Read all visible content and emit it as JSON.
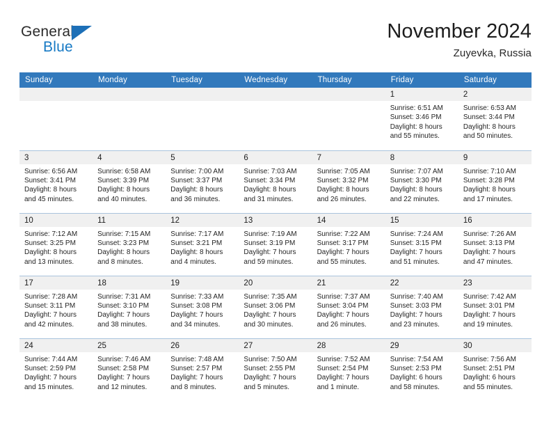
{
  "brand": {
    "name_top": "General",
    "name_bottom": "Blue",
    "accent_color": "#1679c4",
    "triangle_color": "#1c6fb7"
  },
  "header": {
    "title": "November 2024",
    "subtitle": "Zuyevka, Russia"
  },
  "theme": {
    "header_bg": "#3279bc",
    "header_text": "#ffffff",
    "daynum_band_bg": "#f0f0f0",
    "row_separator": "#a9c3dd",
    "cell_bg": "#ffffff",
    "body_text": "#242424"
  },
  "weekday_headers": [
    "Sunday",
    "Monday",
    "Tuesday",
    "Wednesday",
    "Thursday",
    "Friday",
    "Saturday"
  ],
  "labels": {
    "sunrise_prefix": "Sunrise:",
    "sunset_prefix": "Sunset:",
    "daylight_prefix": "Daylight:"
  },
  "weeks": [
    [
      {
        "day": "",
        "empty": true,
        "line1": "",
        "line2": "",
        "line3": "",
        "line4": ""
      },
      {
        "day": "",
        "empty": true,
        "line1": "",
        "line2": "",
        "line3": "",
        "line4": ""
      },
      {
        "day": "",
        "empty": true,
        "line1": "",
        "line2": "",
        "line3": "",
        "line4": ""
      },
      {
        "day": "",
        "empty": true,
        "line1": "",
        "line2": "",
        "line3": "",
        "line4": ""
      },
      {
        "day": "",
        "empty": true,
        "line1": "",
        "line2": "",
        "line3": "",
        "line4": ""
      },
      {
        "day": "1",
        "empty": false,
        "line1": "Sunrise: 6:51 AM",
        "line2": "Sunset: 3:46 PM",
        "line3": "Daylight: 8 hours",
        "line4": "and 55 minutes."
      },
      {
        "day": "2",
        "empty": false,
        "line1": "Sunrise: 6:53 AM",
        "line2": "Sunset: 3:44 PM",
        "line3": "Daylight: 8 hours",
        "line4": "and 50 minutes."
      }
    ],
    [
      {
        "day": "3",
        "empty": false,
        "line1": "Sunrise: 6:56 AM",
        "line2": "Sunset: 3:41 PM",
        "line3": "Daylight: 8 hours",
        "line4": "and 45 minutes."
      },
      {
        "day": "4",
        "empty": false,
        "line1": "Sunrise: 6:58 AM",
        "line2": "Sunset: 3:39 PM",
        "line3": "Daylight: 8 hours",
        "line4": "and 40 minutes."
      },
      {
        "day": "5",
        "empty": false,
        "line1": "Sunrise: 7:00 AM",
        "line2": "Sunset: 3:37 PM",
        "line3": "Daylight: 8 hours",
        "line4": "and 36 minutes."
      },
      {
        "day": "6",
        "empty": false,
        "line1": "Sunrise: 7:03 AM",
        "line2": "Sunset: 3:34 PM",
        "line3": "Daylight: 8 hours",
        "line4": "and 31 minutes."
      },
      {
        "day": "7",
        "empty": false,
        "line1": "Sunrise: 7:05 AM",
        "line2": "Sunset: 3:32 PM",
        "line3": "Daylight: 8 hours",
        "line4": "and 26 minutes."
      },
      {
        "day": "8",
        "empty": false,
        "line1": "Sunrise: 7:07 AM",
        "line2": "Sunset: 3:30 PM",
        "line3": "Daylight: 8 hours",
        "line4": "and 22 minutes."
      },
      {
        "day": "9",
        "empty": false,
        "line1": "Sunrise: 7:10 AM",
        "line2": "Sunset: 3:28 PM",
        "line3": "Daylight: 8 hours",
        "line4": "and 17 minutes."
      }
    ],
    [
      {
        "day": "10",
        "empty": false,
        "line1": "Sunrise: 7:12 AM",
        "line2": "Sunset: 3:25 PM",
        "line3": "Daylight: 8 hours",
        "line4": "and 13 minutes."
      },
      {
        "day": "11",
        "empty": false,
        "line1": "Sunrise: 7:15 AM",
        "line2": "Sunset: 3:23 PM",
        "line3": "Daylight: 8 hours",
        "line4": "and 8 minutes."
      },
      {
        "day": "12",
        "empty": false,
        "line1": "Sunrise: 7:17 AM",
        "line2": "Sunset: 3:21 PM",
        "line3": "Daylight: 8 hours",
        "line4": "and 4 minutes."
      },
      {
        "day": "13",
        "empty": false,
        "line1": "Sunrise: 7:19 AM",
        "line2": "Sunset: 3:19 PM",
        "line3": "Daylight: 7 hours",
        "line4": "and 59 minutes."
      },
      {
        "day": "14",
        "empty": false,
        "line1": "Sunrise: 7:22 AM",
        "line2": "Sunset: 3:17 PM",
        "line3": "Daylight: 7 hours",
        "line4": "and 55 minutes."
      },
      {
        "day": "15",
        "empty": false,
        "line1": "Sunrise: 7:24 AM",
        "line2": "Sunset: 3:15 PM",
        "line3": "Daylight: 7 hours",
        "line4": "and 51 minutes."
      },
      {
        "day": "16",
        "empty": false,
        "line1": "Sunrise: 7:26 AM",
        "line2": "Sunset: 3:13 PM",
        "line3": "Daylight: 7 hours",
        "line4": "and 47 minutes."
      }
    ],
    [
      {
        "day": "17",
        "empty": false,
        "line1": "Sunrise: 7:28 AM",
        "line2": "Sunset: 3:11 PM",
        "line3": "Daylight: 7 hours",
        "line4": "and 42 minutes."
      },
      {
        "day": "18",
        "empty": false,
        "line1": "Sunrise: 7:31 AM",
        "line2": "Sunset: 3:10 PM",
        "line3": "Daylight: 7 hours",
        "line4": "and 38 minutes."
      },
      {
        "day": "19",
        "empty": false,
        "line1": "Sunrise: 7:33 AM",
        "line2": "Sunset: 3:08 PM",
        "line3": "Daylight: 7 hours",
        "line4": "and 34 minutes."
      },
      {
        "day": "20",
        "empty": false,
        "line1": "Sunrise: 7:35 AM",
        "line2": "Sunset: 3:06 PM",
        "line3": "Daylight: 7 hours",
        "line4": "and 30 minutes."
      },
      {
        "day": "21",
        "empty": false,
        "line1": "Sunrise: 7:37 AM",
        "line2": "Sunset: 3:04 PM",
        "line3": "Daylight: 7 hours",
        "line4": "and 26 minutes."
      },
      {
        "day": "22",
        "empty": false,
        "line1": "Sunrise: 7:40 AM",
        "line2": "Sunset: 3:03 PM",
        "line3": "Daylight: 7 hours",
        "line4": "and 23 minutes."
      },
      {
        "day": "23",
        "empty": false,
        "line1": "Sunrise: 7:42 AM",
        "line2": "Sunset: 3:01 PM",
        "line3": "Daylight: 7 hours",
        "line4": "and 19 minutes."
      }
    ],
    [
      {
        "day": "24",
        "empty": false,
        "line1": "Sunrise: 7:44 AM",
        "line2": "Sunset: 2:59 PM",
        "line3": "Daylight: 7 hours",
        "line4": "and 15 minutes."
      },
      {
        "day": "25",
        "empty": false,
        "line1": "Sunrise: 7:46 AM",
        "line2": "Sunset: 2:58 PM",
        "line3": "Daylight: 7 hours",
        "line4": "and 12 minutes."
      },
      {
        "day": "26",
        "empty": false,
        "line1": "Sunrise: 7:48 AM",
        "line2": "Sunset: 2:57 PM",
        "line3": "Daylight: 7 hours",
        "line4": "and 8 minutes."
      },
      {
        "day": "27",
        "empty": false,
        "line1": "Sunrise: 7:50 AM",
        "line2": "Sunset: 2:55 PM",
        "line3": "Daylight: 7 hours",
        "line4": "and 5 minutes."
      },
      {
        "day": "28",
        "empty": false,
        "line1": "Sunrise: 7:52 AM",
        "line2": "Sunset: 2:54 PM",
        "line3": "Daylight: 7 hours",
        "line4": "and 1 minute."
      },
      {
        "day": "29",
        "empty": false,
        "line1": "Sunrise: 7:54 AM",
        "line2": "Sunset: 2:53 PM",
        "line3": "Daylight: 6 hours",
        "line4": "and 58 minutes."
      },
      {
        "day": "30",
        "empty": false,
        "line1": "Sunrise: 7:56 AM",
        "line2": "Sunset: 2:51 PM",
        "line3": "Daylight: 6 hours",
        "line4": "and 55 minutes."
      }
    ]
  ]
}
